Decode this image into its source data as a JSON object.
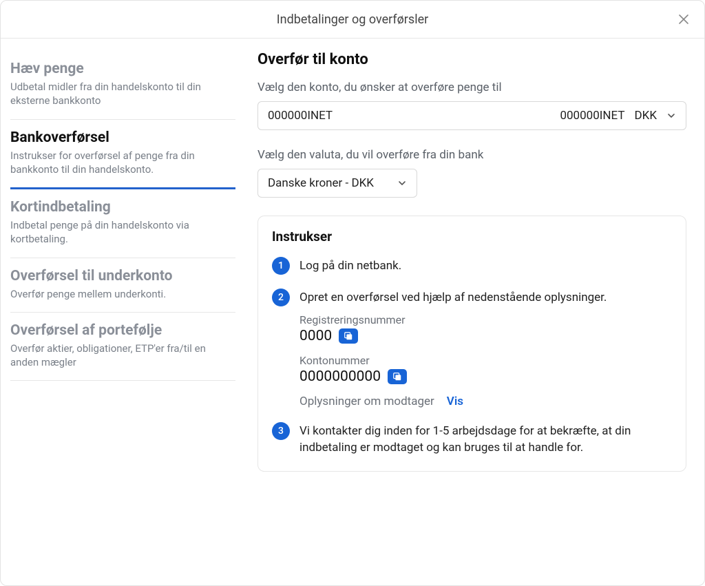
{
  "header": {
    "title": "Indbetalinger og overførsler"
  },
  "sidebar": {
    "items": [
      {
        "title": "Hæv penge",
        "desc": "Udbetal midler fra din handelskonto til din eksterne bankkonto"
      },
      {
        "title": "Bankoverførsel",
        "desc": "Instrukser for overførsel af penge fra din bankkonto til din handelskonto."
      },
      {
        "title": "Kortindbetaling",
        "desc": "Indbetal penge på din handelskonto via kortbetaling."
      },
      {
        "title": "Overførsel til underkonto",
        "desc": "Overfør penge mellem underkonti."
      },
      {
        "title": "Overførsel af portefølje",
        "desc": "Overfør aktier, obligationer, ETP'er fra/til en anden mægler"
      }
    ]
  },
  "main": {
    "title": "Overfør til konto",
    "account_label": "Vælg den konto, du ønsker at overføre penge til",
    "account_left": "000000INET",
    "account_right_id": "000000INET",
    "account_right_ccy": "DKK",
    "currency_label": "Vælg den valuta, du vil overføre fra din bank",
    "currency_value": "Danske kroner - DKK",
    "instructions_title": "Instrukser",
    "steps": {
      "s1": "Log på din netbank.",
      "s2": "Opret en overførsel ved hjælp af nedenstående oplysninger.",
      "reg_label": "Registreringsnummer",
      "reg_value": "0000",
      "acct_label": "Kontonummer",
      "acct_value": "0000000000",
      "recipient_label": "Oplysninger om modtager",
      "show": "Vis",
      "s3": "Vi kontakter dig inden for 1-5 arbejdsdage for at bekræfte, at din indbetaling er modtaget og kan bruges til at handle for."
    }
  }
}
